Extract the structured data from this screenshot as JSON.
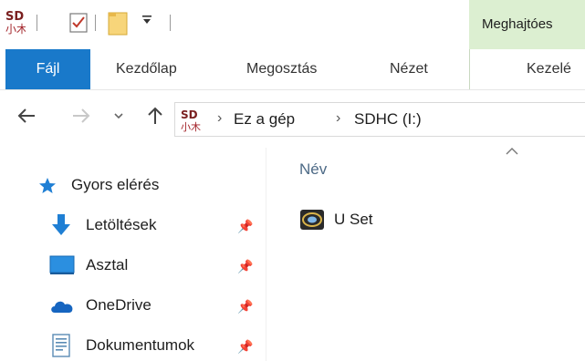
{
  "quick_access_toolbar": {
    "sd_icon_top": "SD",
    "sd_icon_bottom": "小木",
    "icons": [
      "sd-logo-icon",
      "properties-check-icon",
      "new-folder-icon",
      "customize-dropdown-icon"
    ]
  },
  "context_tab": {
    "label": "Meghajtóes"
  },
  "ribbon_tabs": {
    "file": "Fájl",
    "home": "Kezdőlap",
    "share": "Megosztás",
    "view": "Nézet",
    "manage": "Kezelé"
  },
  "navigation": {
    "back_icon": "back-arrow-icon",
    "forward_icon": "forward-arrow-icon",
    "recent_icon": "recent-locations-icon",
    "up_icon": "up-arrow-icon"
  },
  "breadcrumb": {
    "items": [
      "Ez a gép",
      "SDHC (I:)"
    ]
  },
  "nav_pane": {
    "quick_access": "Gyors elérés",
    "items": [
      {
        "label": "Letöltések",
        "icon": "download-icon",
        "pinned": true
      },
      {
        "label": "Asztal",
        "icon": "desktop-icon",
        "pinned": true
      },
      {
        "label": "OneDrive",
        "icon": "onedrive-icon",
        "pinned": true
      },
      {
        "label": "Dokumentumok",
        "icon": "documents-icon",
        "pinned": true
      }
    ]
  },
  "content": {
    "column_header": "Név",
    "files": [
      {
        "name": "U Set",
        "icon": "application-icon"
      }
    ]
  },
  "colors": {
    "file_tab": "#1979ca",
    "context_tab": "#dcefd1",
    "column_header": "#4d6a86"
  }
}
